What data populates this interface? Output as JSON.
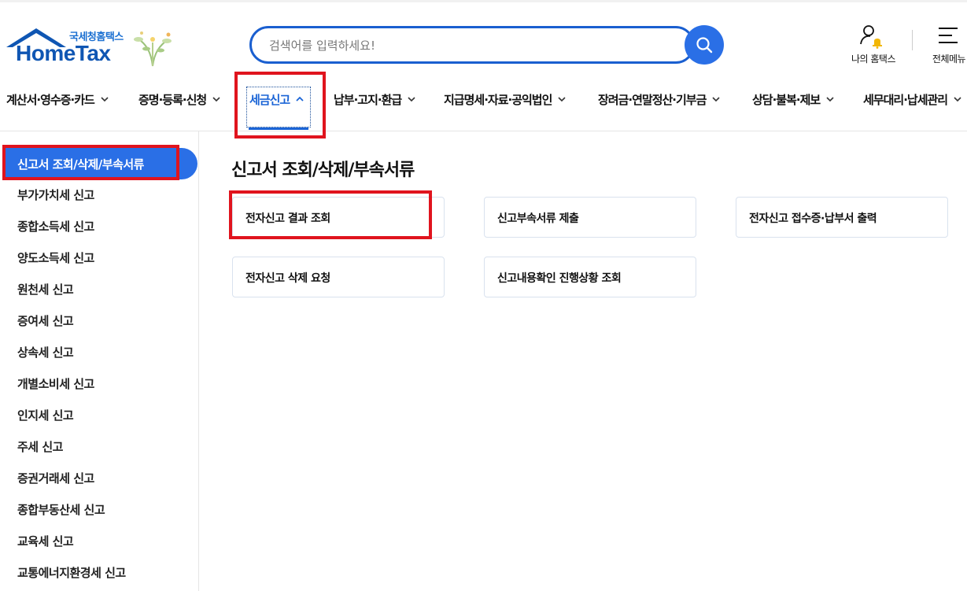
{
  "header": {
    "logo_sub": "국세청홈택스",
    "logo_main": "HomeTax",
    "search_placeholder": "검색어를 입력하세요!",
    "my_hometax": "나의 홈택스",
    "all_menu": "전체메뉴"
  },
  "gnb": [
    {
      "label": "계산서·영수증·카드"
    },
    {
      "label": "증명·등록·신청"
    },
    {
      "label": "세금신고"
    },
    {
      "label": "납부·고지·환급"
    },
    {
      "label": "지급명세·자료·공익법인"
    },
    {
      "label": "장려금·연말정산·기부금"
    },
    {
      "label": "상담·불복·제보"
    },
    {
      "label": "세무대리·납세관리"
    }
  ],
  "sidebar": {
    "active": "신고서 조회/삭제/부속서류",
    "items": [
      "부가가치세 신고",
      "종합소득세 신고",
      "양도소득세 신고",
      "원천세 신고",
      "증여세 신고",
      "상속세 신고",
      "개별소비세 신고",
      "인지세 신고",
      "주세 신고",
      "증권거래세 신고",
      "종합부동산세 신고",
      "교육세 신고",
      "교통에너지환경세 신고"
    ]
  },
  "main": {
    "title": "신고서 조회/삭제/부속서류",
    "cards": [
      "전자신고 결과 조회",
      "신고부속서류 제출",
      "전자신고 접수증·납부서 출력",
      "전자신고 삭제 요청",
      "신고내용확인 진행상황 조회"
    ]
  },
  "colors": {
    "brand_blue": "#1a64d6",
    "highlight_red": "#e0141e"
  }
}
